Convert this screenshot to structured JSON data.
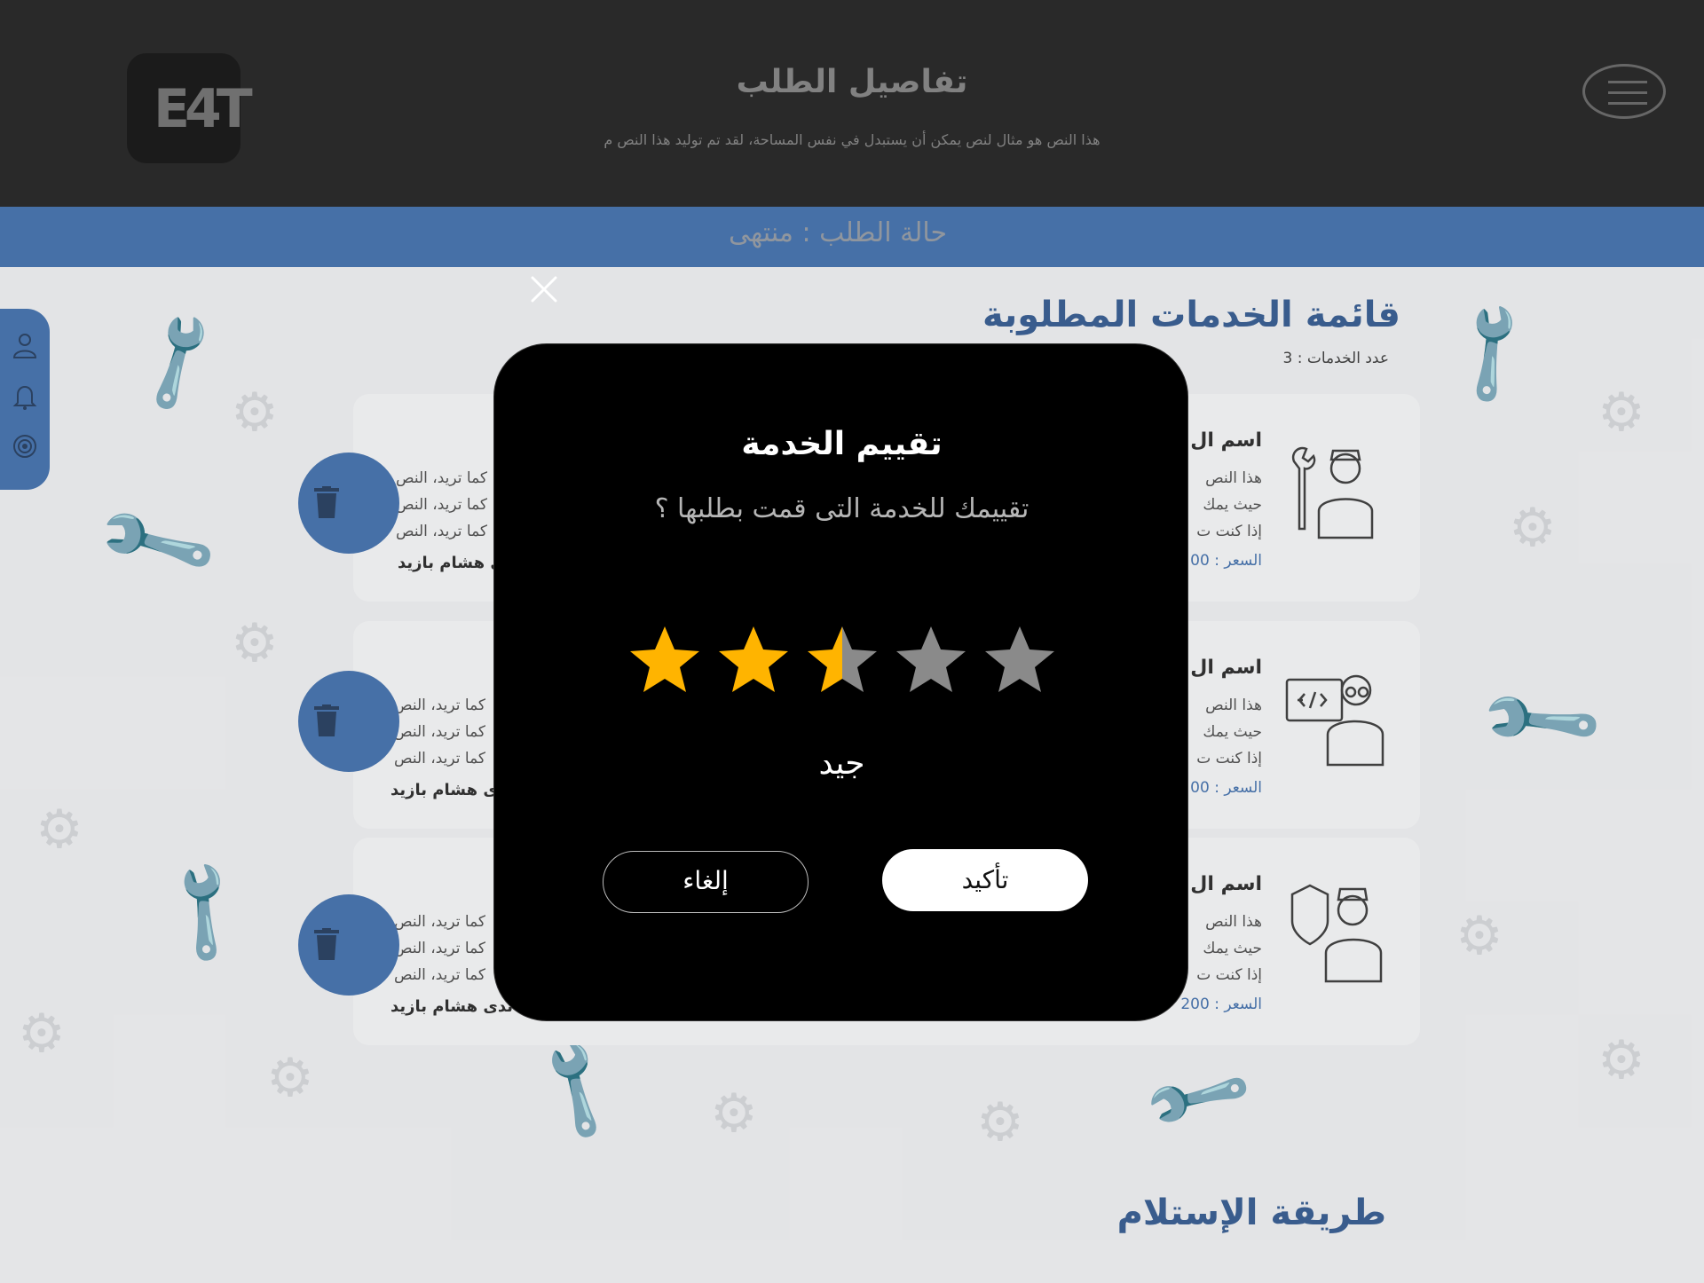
{
  "header": {
    "logo_text": "E4T",
    "title": "تفاصيل الطلب",
    "subtitle": "هذا النص هو مثال لنص يمكن أن يستبدل في نفس المساحة، لقد تم توليد هذا النص م"
  },
  "status": {
    "text": "حالة الطلب : منتهى"
  },
  "services": {
    "title": "قائمة الخدمات المطلوبة",
    "count": "عدد الخدمات : 3",
    "items": [
      {
        "name": "اسم ال",
        "desc_lines": [
          "هذا النص",
          "حيث يمك",
          "إذا كنت ت"
        ],
        "price": "السعر : 00",
        "left_lines": [
          "كما تريد، النص",
          "كما تريد، النص",
          "كما تريد، النص"
        ],
        "owner": "ى هشام بازيد"
      },
      {
        "name": "اسم ال",
        "desc_lines": [
          "هذا النص",
          "حيث يمك",
          "إذا كنت ت"
        ],
        "price": "السعر : 00",
        "left_lines": [
          "كما تريد، النص",
          "كما تريد، النص",
          "كما تريد، النص"
        ],
        "owner": "دى هشام بازيد"
      },
      {
        "name": "اسم ال",
        "desc_lines": [
          "هذا النص",
          "حيث يمك",
          "إذا كنت ت"
        ],
        "price": "السعر : 200",
        "left_lines": [
          "كما تريد، النص",
          "كما تريد، النص",
          "كما تريد، النص"
        ],
        "owner": ": ندى هشام بازيد"
      }
    ]
  },
  "delivery": {
    "title": "طريقة الإستلام"
  },
  "modal": {
    "title": "تقييم الخدمة",
    "question": "تقييمك للخدمة التى قمت بطلبها ؟",
    "rating_value": 2.5,
    "rating_max": 5,
    "rating_label": "جيد",
    "confirm_label": "تأكيد",
    "cancel_label": "إلغاء"
  },
  "colors": {
    "header_bg": "#2c2c2c",
    "accent": "#4b77b2",
    "star_fill": "#ffb400",
    "star_empty": "#8a8a8a",
    "modal_bg": "#000000"
  },
  "icons": {
    "menu": "hamburger-menu-icon",
    "close": "close-icon",
    "profile": "user-icon",
    "notifications": "bell-icon",
    "settings": "gear-icon",
    "delete": "trash-icon"
  }
}
